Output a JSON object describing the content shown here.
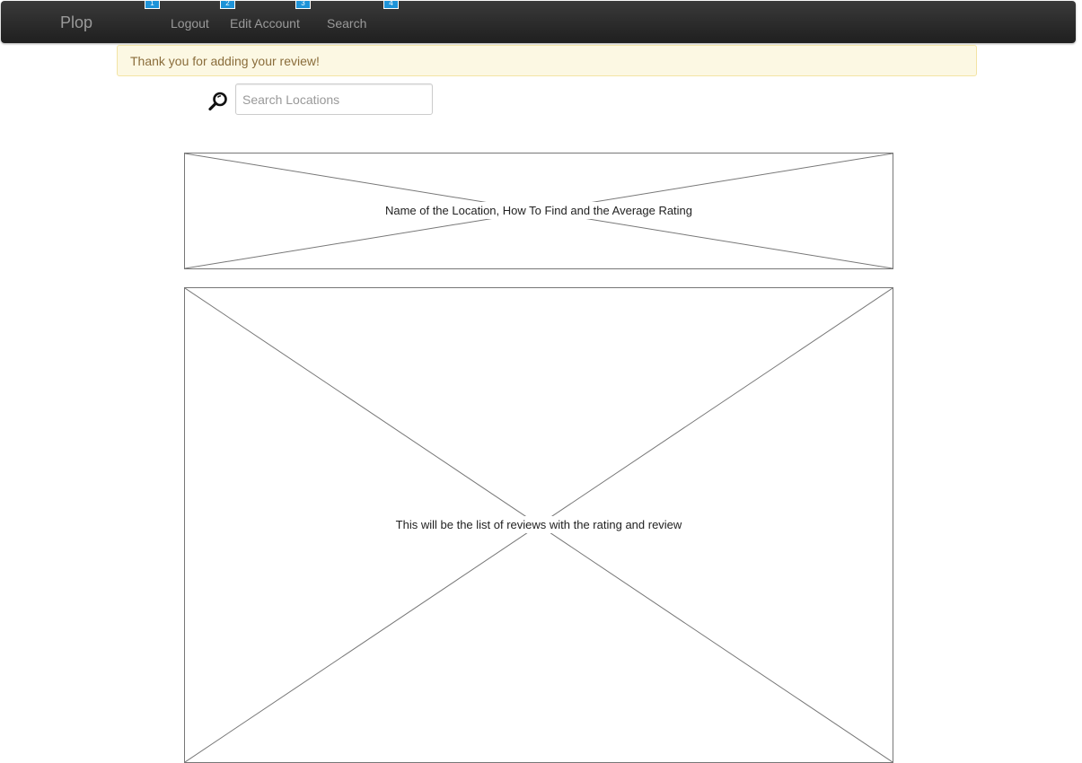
{
  "navbar": {
    "brand": "Plop",
    "items": [
      {
        "label": "Logout",
        "marker": "1"
      },
      {
        "label": "Edit Account",
        "marker": "2"
      },
      {
        "label": "Search",
        "marker": "3"
      }
    ],
    "extra_marker": "4"
  },
  "alert": {
    "message": "Thank you for adding your review!"
  },
  "search": {
    "placeholder": "Search Locations",
    "value": ""
  },
  "location_box": {
    "label": "Name of the Location, How To Find and the Average Rating"
  },
  "reviews_box": {
    "label": "This will be the list of reviews with the rating and review"
  },
  "colors": {
    "navbar": "#222222",
    "marker": "#1e93d8",
    "alert_bg": "#fcf8e3",
    "alert_text": "#8a6d3b"
  }
}
